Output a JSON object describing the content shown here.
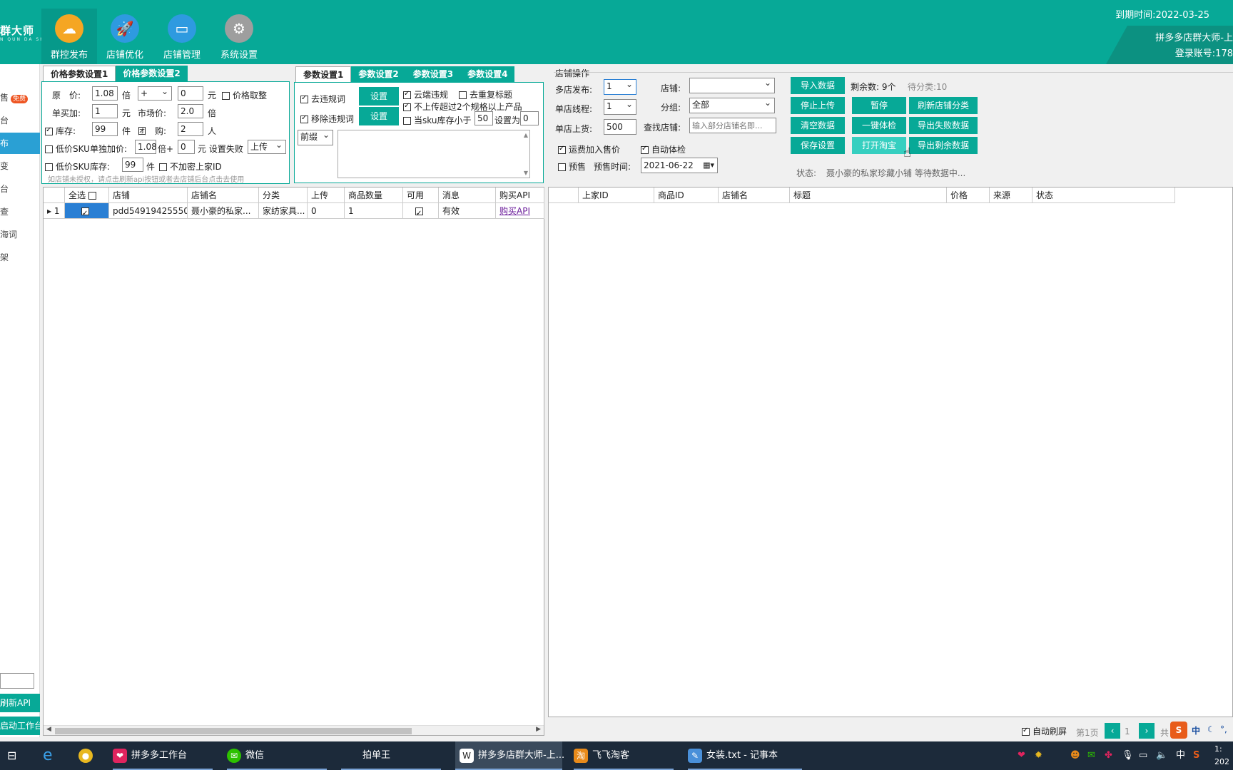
{
  "header": {
    "logo": "群大师",
    "logo_sub": "N QUN DA SHI",
    "nav": [
      {
        "label": "群控发布",
        "icon": "cloud-upload-icon",
        "color": "#f5a623"
      },
      {
        "label": "店铺优化",
        "icon": "rocket-icon",
        "color": "#2e9ae0"
      },
      {
        "label": "店铺管理",
        "icon": "monitor-icon",
        "color": "#2e9ae0"
      },
      {
        "label": "系统设置",
        "icon": "gear-icon",
        "color": "#9e9e9e"
      }
    ],
    "expiry": "到期时间:2022-03-25",
    "shop_title": "拼多多店群大师-上",
    "account": "登录账号:178"
  },
  "sidebar": {
    "items": [
      "售",
      "台",
      "布",
      "变",
      "台",
      "查",
      "海词",
      "架"
    ],
    "free_badge": "免费",
    "refresh_api": "刷新API",
    "start_workbench": "启动工作台"
  },
  "price_panel": {
    "tabs": [
      "价格参数设置1",
      "价格参数设置2"
    ],
    "original_price_label": "原　价:",
    "original_price": "1.08",
    "times": "倍",
    "op": "+",
    "add_value": "0",
    "yuan": "元",
    "round_price": "价格取整",
    "buy_add_label": "单买加:",
    "buy_add": "1",
    "market_price_label": "市场价:",
    "market_price": "2.0",
    "stock_label": "库存:",
    "stock": "99",
    "piece": "件",
    "group_label": "团　购:",
    "group": "2",
    "person": "人",
    "low_sku_add_label": "低价SKU单独加价:",
    "low_sku_mult": "1.08",
    "times_plus": "倍+",
    "low_sku_add": "0",
    "fail_label": "元 设置失败",
    "fail_action": "上传",
    "low_sku_stock_label": "低价SKU库存:",
    "low_sku_stock": "99",
    "no_encrypt": "不加密上家ID",
    "hint": "如店铺未授权，请点击刷新api按钮或者去店铺后台点击去使用"
  },
  "param_panel": {
    "tabs": [
      "参数设置1",
      "参数设置2",
      "参数设置3",
      "参数设置4"
    ],
    "remove_violation": "去违规词",
    "remove_violation_words": "移除违规词",
    "set": "设置",
    "cloud_violation": "云端违规",
    "remove_dup_title": "去重复标题",
    "no_upload_over2": "不上传超过2个规格以上产品",
    "sku_stock_less": "当sku库存小于",
    "sku_threshold": "50",
    "set_to": "设置为",
    "sku_set_value": "0",
    "prefix": "前缀"
  },
  "shop_ops": {
    "title": "店铺操作",
    "multi_publish_label": "多店发布:",
    "multi_publish": "1",
    "shop_label": "店铺:",
    "shop": "",
    "single_thread_label": "单店线程:",
    "single_thread": "1",
    "group_label": "分组:",
    "group": "全部",
    "single_upload_label": "单店上货:",
    "single_upload": "500",
    "find_shop_label": "查找店铺:",
    "find_shop_placeholder": "输入部分店铺名即...",
    "freight_add": "运费加入售价",
    "auto_check": "自动体检",
    "presale": "预售",
    "presale_time_label": "预售时间:",
    "presale_time": "2021-06-22",
    "buttons": {
      "import": "导入数据",
      "stop_upload": "停止上传",
      "pause": "暂停",
      "refresh_category": "刷新店铺分类",
      "clear": "清空数据",
      "one_check": "一键体检",
      "export_fail": "导出失败数据",
      "save": "保存设置",
      "open_taobao": "打开淘宝",
      "export_remaining": "导出剩余数据"
    },
    "remaining": "剩余数:  9个",
    "pending": "待分类:10",
    "status_label": "状态:",
    "status_text": "聂小豪的私家珍藏小铺 等待数据中..."
  },
  "shop_grid": {
    "columns": [
      "",
      "全选",
      "店铺",
      "店铺名",
      "分类",
      "上传",
      "商品数量",
      "可用",
      "消息",
      "购买API"
    ],
    "rows": [
      {
        "index": "1",
        "shop": "pdd54919425550",
        "name": "聂小豪的私家...",
        "category": "家纺家具...",
        "upload": "0",
        "count": "1",
        "message": "有效",
        "buy_api": "购买API"
      }
    ]
  },
  "product_grid": {
    "columns": [
      "",
      "上家ID",
      "商品ID",
      "店铺名",
      "标题",
      "价格",
      "来源",
      "状态"
    ]
  },
  "pager": {
    "auto_refresh": "自动刷屏",
    "page_label": "第1页",
    "page": "1",
    "total": "共"
  },
  "taskbar": {
    "items": [
      {
        "label": "拼多多工作台",
        "icon": "pdd-icon",
        "color": "#e0245e"
      },
      {
        "label": "微信",
        "icon": "wechat-icon",
        "color": "#2dc100"
      },
      {
        "label": "拍单王",
        "icon": "",
        "color": ""
      },
      {
        "label": "拼多多店群大师-上...",
        "icon": "app-icon",
        "color": "#222"
      },
      {
        "label": "飞飞淘客",
        "icon": "taoke-icon",
        "color": "#e88a1a"
      },
      {
        "label": "女装.txt - 记事本",
        "icon": "notepad-icon",
        "color": "#4a90d9"
      }
    ],
    "ime": "中",
    "time": "1:",
    "date": "202"
  }
}
